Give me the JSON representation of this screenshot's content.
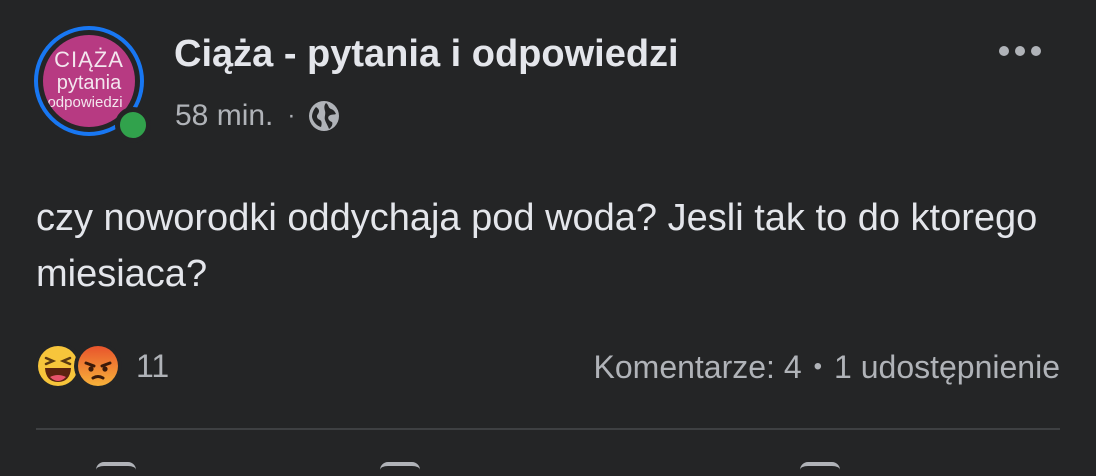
{
  "post": {
    "author": "Ciąża - pytania i odpowiedzi",
    "avatar_text": [
      "CIĄŻA",
      "pytania",
      "odpowiedzi"
    ],
    "time": "58 min.",
    "separator": "·",
    "audience_icon": "globe-icon",
    "more_icon": "more-options-icon",
    "text": "czy noworodki oddychaja pod woda? Jesli tak to do ktorego miesiaca?"
  },
  "footer": {
    "reactions": [
      "haha-reaction-icon",
      "angry-reaction-icon"
    ],
    "reaction_count": "11",
    "comments": "Komentarze: 4",
    "separator": "•",
    "shares": "1 udostępnienie"
  },
  "colors": {
    "background": "#242526",
    "text_primary": "#e4e6eb",
    "text_secondary": "#b0b3b8",
    "avatar_ring": "#1877f2",
    "avatar_fill": "#b73a82",
    "online": "#31a24c",
    "divider": "#3e4042"
  }
}
